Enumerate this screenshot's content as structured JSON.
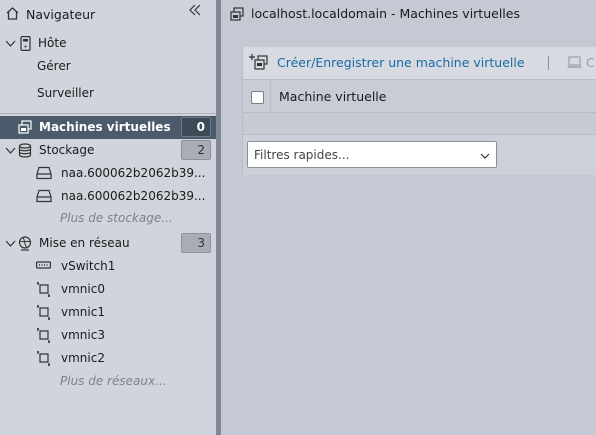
{
  "navigator": {
    "title": "Navigateur",
    "host": {
      "label": "Hôte",
      "children": [
        "Gérer",
        "Surveiller"
      ]
    },
    "vms": {
      "label": "Machines virtuelles",
      "count": "0"
    },
    "storage": {
      "label": "Stockage",
      "count": "2",
      "items": [
        "naa.600062b2062b39...",
        "naa.600062b2062b39..."
      ],
      "more": "Plus de stockage..."
    },
    "network": {
      "label": "Mise en réseau",
      "count": "3",
      "items": [
        "vSwitch1",
        "vmnic0",
        "vmnic1",
        "vmnic3",
        "vmnic2"
      ],
      "more": "Plus de réseaux..."
    }
  },
  "main": {
    "title": "localhost.localdomain - Machines virtuelles",
    "toolbar": {
      "create_label": "Créer/Enregistrer une machine virtuelle",
      "console_label": "C"
    },
    "table": {
      "column": "Machine virtuelle"
    },
    "filter": {
      "placeholder": "Filtres rapides..."
    }
  }
}
